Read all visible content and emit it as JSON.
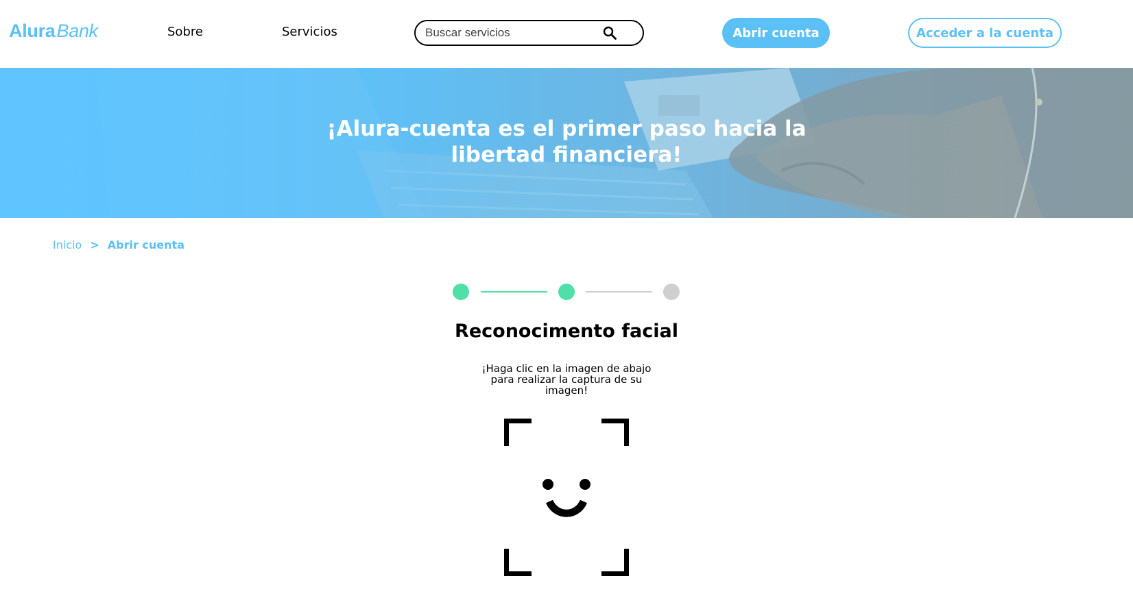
{
  "brand": {
    "name_bold": "Alura",
    "name_italic": "Bank"
  },
  "nav": {
    "items": [
      "Sobre",
      "Servicios"
    ]
  },
  "search": {
    "placeholder": "Buscar servicios",
    "icon": "search-icon"
  },
  "header_buttons": {
    "open_account": "Abrir cuenta",
    "access_account": "Acceder a la cuenta"
  },
  "hero": {
    "title": "¡Alura-cuenta es el primer paso hacia la libertad financiera!"
  },
  "breadcrumb": {
    "home": "Inicio",
    "separator": ">",
    "current": "Abrir cuenta"
  },
  "stepper": {
    "total_steps": 3,
    "completed_steps": 2,
    "active_color": "#4fe0a8",
    "inactive_color": "#cfcfcf"
  },
  "section": {
    "title": "Reconocimento facial",
    "instructions": "¡Haga clic en la imagen de abajo para realizar la captura de su imagen!"
  },
  "capture": {
    "icon": "face-scan-icon"
  },
  "colors": {
    "accent": "#5bc0f5",
    "hero_overlay": "#5fc4ff",
    "success": "#4fe0a8"
  }
}
